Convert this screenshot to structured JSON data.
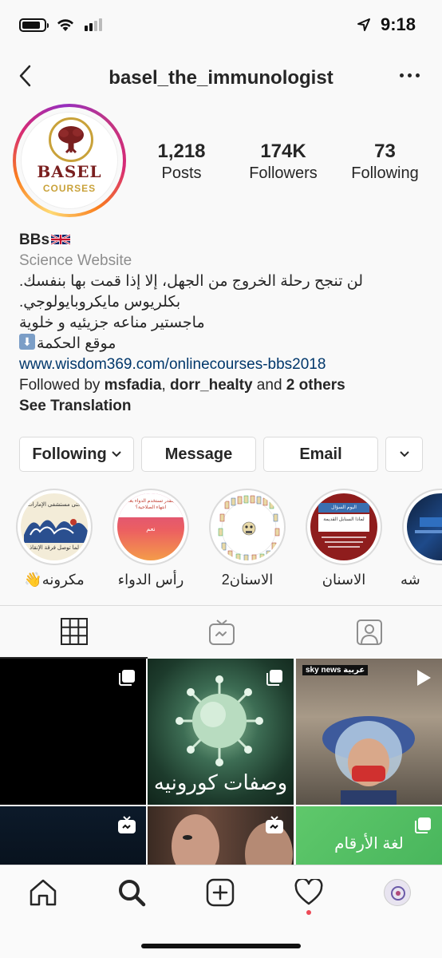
{
  "status_bar": {
    "time": "9:18",
    "battery_level": 0.85,
    "icons": [
      "battery-icon",
      "wifi-icon",
      "cellular-icon",
      "location-arrow-icon"
    ]
  },
  "header": {
    "username": "basel_the_immunologist",
    "back_icon": "chevron-left-icon",
    "more_icon": "ellipsis-icon"
  },
  "profile": {
    "logo_text_main": "BASEL",
    "logo_text_sub": "COURSES",
    "stats": [
      {
        "value": "1,218",
        "label": "Posts"
      },
      {
        "value": "174K",
        "label": "Followers"
      },
      {
        "value": "73",
        "label": "Following"
      }
    ]
  },
  "bio": {
    "name": "BBs",
    "category": "Science Website",
    "lines": [
      "لن تنجح رحلة الخروج من الجهل، إلا إذا قمت بها بنفسك.",
      "بكلريوس مايكروبايولوجي.",
      "ماجستير مناعه جزيئيه و خلوية",
      "موقع الحكمة"
    ],
    "link": "www.wisdom369.com/onlinecourses-bbs2018",
    "followed_prefix": "Followed by ",
    "followed_user1": "msfadia",
    "followed_sep": ", ",
    "followed_user2": "dorr_healty",
    "followed_and": " and ",
    "followed_others": "2 others",
    "see_translation": "See Translation"
  },
  "actions": {
    "following": "Following",
    "message": "Message",
    "email": "Email"
  },
  "highlights": [
    {
      "label": "مكرونه👋"
    },
    {
      "label": "رأس الدواء"
    },
    {
      "label": "الاسنان2"
    },
    {
      "label": "الاسنان"
    },
    {
      "label": "شه"
    }
  ],
  "highlight_texts": {
    "h1_top": "حتى مستشفى الإمارات",
    "h1_bottom": "لما توصل فرقة الإنقاذ",
    "h2_top": "بتقدر تستخدم الدواء بعد انتهاء الصلاحية؟",
    "h2_mid": "نعم",
    "h4_top": "اليوم السؤال",
    "h4_mid": "لماذا السنابل القديمة"
  },
  "tabs": [
    {
      "icon": "grid-icon"
    },
    {
      "icon": "igtv-icon"
    },
    {
      "icon": "tagged-icon"
    }
  ],
  "grid": {
    "post2_caption": "وصفات كورونيه",
    "post3_source": "sky news عربية",
    "post6_caption": "لغة الأرقام"
  },
  "bottom_nav": [
    "home-icon",
    "search-icon",
    "new-post-icon",
    "activity-heart-icon",
    "profile-avatar-icon"
  ],
  "colors": {
    "link": "#00376b",
    "secondary_text": "#8e8e8e",
    "notification_dot": "#ed4956",
    "logo_gold": "#c9a23a",
    "logo_maroon": "#7a1f1f"
  }
}
